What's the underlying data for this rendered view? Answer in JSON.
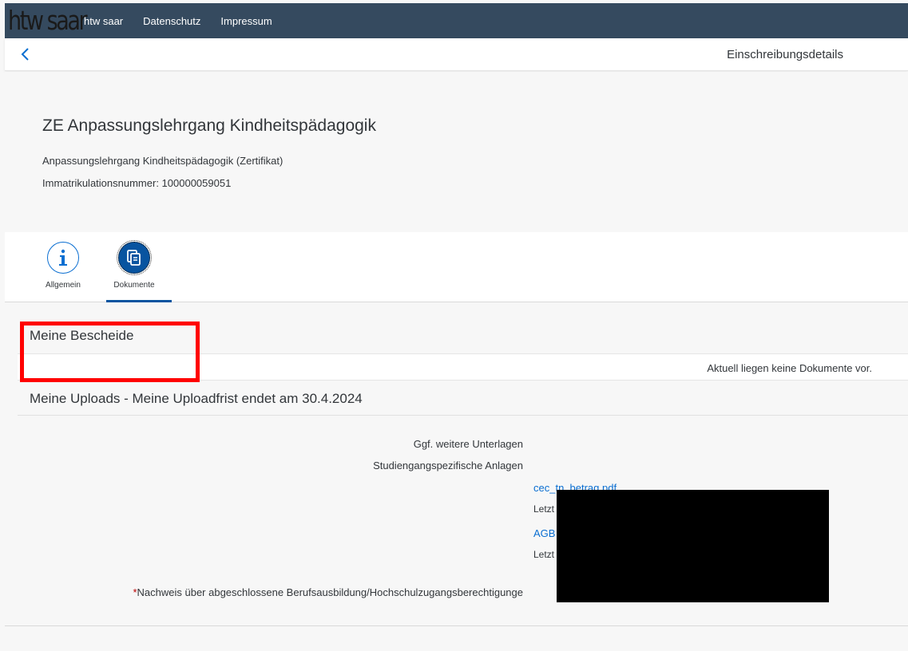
{
  "topbar": {
    "logo_text": "htw saar",
    "nav": [
      "htw saar",
      "Datenschutz",
      "Impressum"
    ],
    "bg_color": "#354a5f"
  },
  "subheader": {
    "back_icon": "chevron-left-icon",
    "title": "Einschreibungsdetails"
  },
  "object_header": {
    "title": "ZE Anpassungslehrgang Kindheitspädagogik",
    "subtitle": "Anpassungslehrgang Kindheitspädagogik (Zertifikat)",
    "matrikel": "Immatrikulationsnummer: 100000059051"
  },
  "tabs": [
    {
      "label": "Allgemein",
      "icon": "info-icon",
      "selected": false
    },
    {
      "label": "Dokumente",
      "icon": "documents-icon",
      "selected": true
    }
  ],
  "bescheide": {
    "title": "Meine Bescheide",
    "empty_text": "Aktuell liegen keine Dokumente vor."
  },
  "uploads": {
    "title": "Meine Uploads - Meine Uploadfrist endet am 30.4.2024",
    "labels": {
      "weitere": "Ggf. weitere Unterlagen",
      "anlagen": "Studiengangspezifische Anlagen",
      "nachweis_star": "*",
      "nachweis": "Nachweis über abgeschlossene Berufsausbildung/Hochschulzugangsberechtigunge"
    },
    "files": [
      {
        "name": "cec_tn_betrag.pdf",
        "meta": "Letzt"
      },
      {
        "name": "AGB",
        "meta": "Letzt"
      }
    ]
  },
  "colors": {
    "accent": "#0a6ed1",
    "tab_selected": "#0854a0",
    "highlight": "#ff0000",
    "redaction": "#000000"
  }
}
